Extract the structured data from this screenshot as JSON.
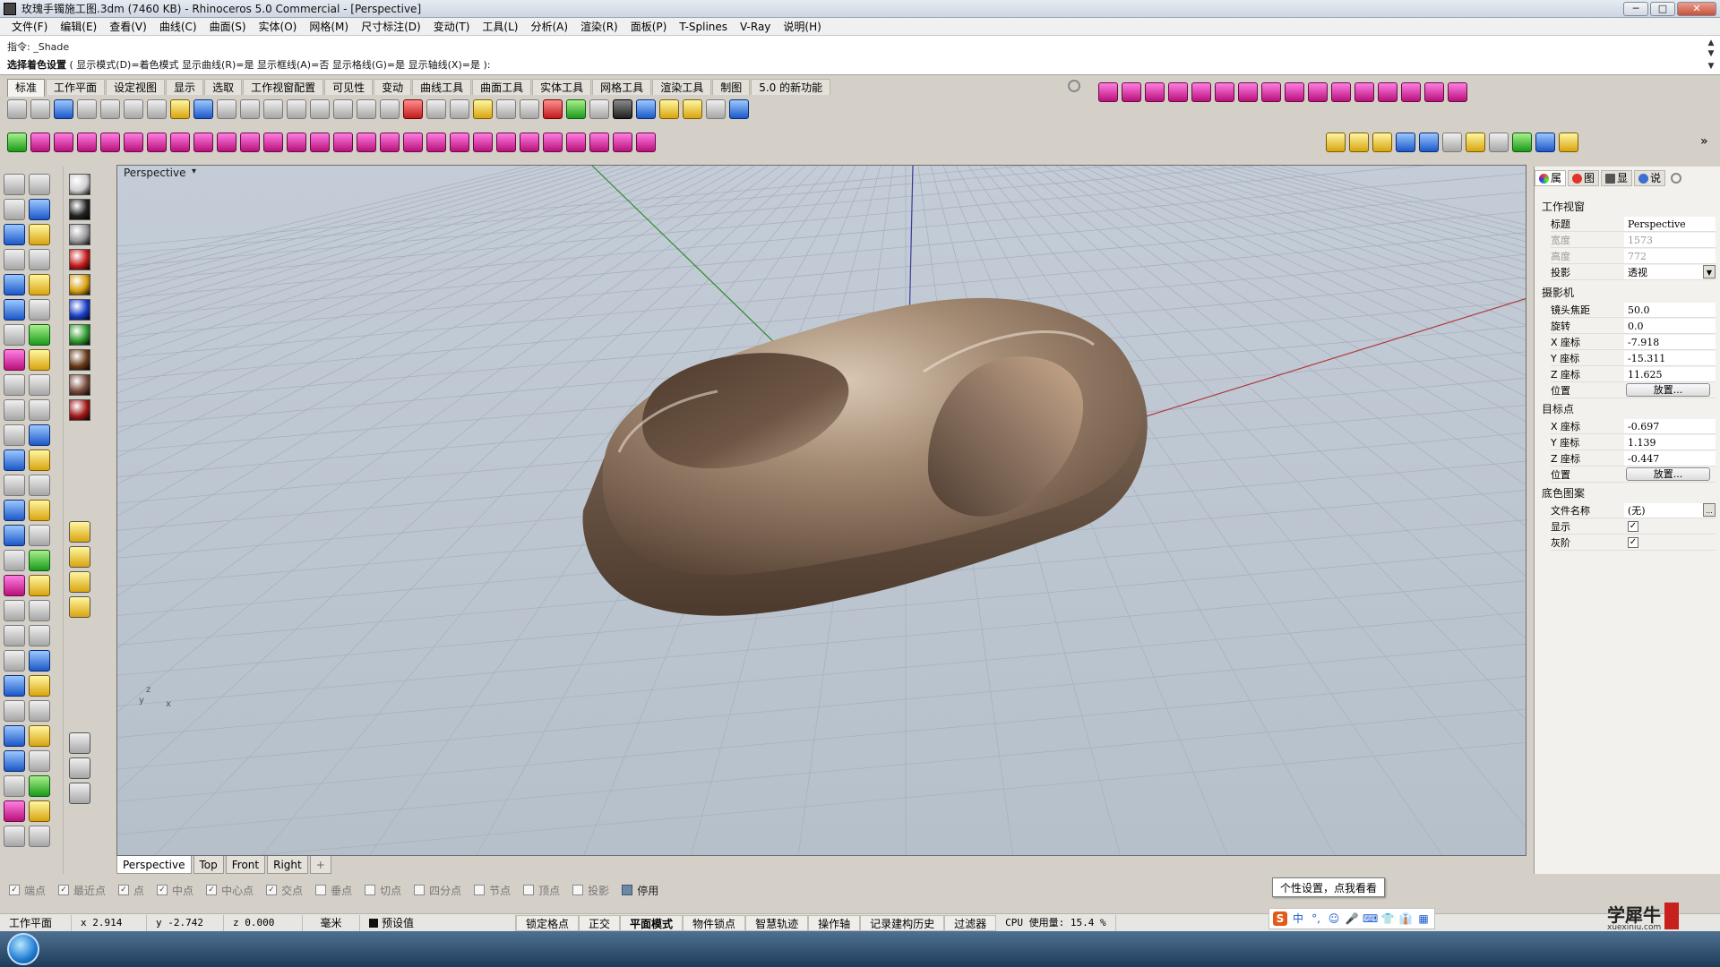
{
  "window": {
    "title": "玫瑰手镯施工图.3dm (7460 KB) - Rhinoceros 5.0 Commercial - [Perspective]",
    "buttons": {
      "minimize": "─",
      "maximize": "□",
      "close": "✕"
    }
  },
  "menubar": [
    "文件(F)",
    "编辑(E)",
    "查看(V)",
    "曲线(C)",
    "曲面(S)",
    "实体(O)",
    "网格(M)",
    "尺寸标注(D)",
    "变动(T)",
    "工具(L)",
    "分析(A)",
    "渲染(R)",
    "面板(P)",
    "T-Splines",
    "V-Ray",
    "说明(H)"
  ],
  "command": {
    "history_prefix": "指令:",
    "history_value": "_Shade",
    "prompt_label": "选择着色设置",
    "prompt_options": "( 显示模式(D)=着色模式  显示曲线(R)=是  显示框线(A)=否  显示格线(G)=是  显示轴线(X)=是 ):"
  },
  "tabs": [
    "标准",
    "工作平面",
    "设定视图",
    "显示",
    "选取",
    "工作视窗配置",
    "可见性",
    "变动",
    "曲线工具",
    "曲面工具",
    "实体工具",
    "网格工具",
    "渲染工具",
    "制图",
    "5.0 的新功能"
  ],
  "toolbar_row1_icons": [
    "new-icon",
    "open-icon",
    "save-icon",
    "print-icon",
    "import-icon",
    "cut-icon",
    "copy-icon",
    "paste-icon",
    "undo-icon",
    "pan-icon",
    "rotate-view-icon",
    "zoom-icon",
    "zoom-window-icon",
    "zoom-extents-icon",
    "zoom-selected-icon",
    "zoom-all-icon",
    "four-view-icon",
    "car-icon",
    "tools-icon",
    "target-icon",
    "light-icon",
    "bulb-icon",
    "lock-icon",
    "shield-icon",
    "color-wheel-icon",
    "sphere-icon",
    "sphere2-icon",
    "render-sphere-icon",
    "paintbrush-icon",
    "gear-icon",
    "dimension-icon",
    "help-icon"
  ],
  "toolbar_row2_icons": [
    "power-icon",
    "tsplines-box-icon",
    "tsplines-cube-icon",
    "tsplines-sphere-icon",
    "tsplines-cylinder-icon",
    "tsplines-torus-icon",
    "tsplines-plane-icon",
    "tsplines-face-icon",
    "tsplines-edge-icon",
    "tsplines-vertex-icon",
    "tsplines-extrude-icon",
    "tsplines-bridge-icon",
    "tsplines-weld-icon",
    "tsplines-crease-icon",
    "tsplines-smooth-icon",
    "tsplines-box-mode-icon",
    "tsplines-grid-icon",
    "tsplines-symmetry-icon",
    "tsplines-split-icon",
    "tsplines-merge-icon",
    "tsplines-fill-icon",
    "tsplines-subdivide-icon",
    "tsplines-append-icon",
    "tsplines-insert-icon",
    "tsplines-delete-icon",
    "tsplines-manip-icon",
    "tsplines-convert-icon",
    "tsplines-repair-icon"
  ],
  "vray_icons": [
    "vray-m-icon",
    "vray-material-icon",
    "vray-tag-icon",
    "vray-r-icon",
    "vray-rt-icon",
    "vray-light-icon",
    "vray-sun-icon",
    "vray-dome-icon",
    "vray-env-icon",
    "vray-help-icon",
    "vray-options-icon"
  ],
  "viewport": {
    "label": "Perspective",
    "menu_arrow": "▾",
    "axis_y": "y",
    "axis_z": "z",
    "axis_x": "x"
  },
  "viewport_tabs": [
    "Perspective",
    "Top",
    "Front",
    "Right",
    "+"
  ],
  "osnap": [
    {
      "label": "端点",
      "checked": true
    },
    {
      "label": "最近点",
      "checked": true
    },
    {
      "label": "点",
      "checked": true
    },
    {
      "label": "中点",
      "checked": true
    },
    {
      "label": "中心点",
      "checked": true
    },
    {
      "label": "交点",
      "checked": true
    },
    {
      "label": "垂点",
      "checked": false
    },
    {
      "label": "切点",
      "checked": false
    },
    {
      "label": "四分点",
      "checked": false
    },
    {
      "label": "节点",
      "checked": false
    },
    {
      "label": "顶点",
      "checked": false
    },
    {
      "label": "投影",
      "checked": false
    },
    {
      "label": "停用",
      "checked": false
    }
  ],
  "statusbar": {
    "cplane": "工作平面",
    "x": "x 2.914",
    "y": "y -2.742",
    "z": "z 0.000",
    "units": "毫米",
    "layer": "预设值",
    "buttons": [
      "锁定格点",
      "正交",
      "平面模式",
      "物件锁点",
      "智慧轨迹",
      "操作轴",
      "记录建构历史",
      "过滤器"
    ],
    "cpu": "CPU 使用量: 15.4 %"
  },
  "properties": {
    "tabs": [
      "属",
      "图",
      "显",
      "说"
    ],
    "section_viewport": "工作视窗",
    "title_label": "标题",
    "title_value": "Perspective",
    "width_label": "宽度",
    "width_value": "1573",
    "height_label": "高度",
    "height_value": "772",
    "projection_label": "投影",
    "projection_value": "透视",
    "section_camera": "摄影机",
    "focal_label": "镜头焦距",
    "focal_value": "50.0",
    "rotation_label": "旋转",
    "rotation_value": "0.0",
    "cam_x_label": "X 座标",
    "cam_x_value": "-7.918",
    "cam_y_label": "Y 座标",
    "cam_y_value": "-15.311",
    "cam_z_label": "Z 座标",
    "cam_z_value": "11.625",
    "cam_pos_label": "位置",
    "place_button": "放置...",
    "section_target": "目标点",
    "tgt_x_label": "X 座标",
    "tgt_x_value": "-0.697",
    "tgt_y_label": "Y 座标",
    "tgt_y_value": "1.139",
    "tgt_z_label": "Z 座标",
    "tgt_z_value": "-0.447",
    "tgt_pos_label": "位置",
    "section_background": "底色图案",
    "filename_label": "文件名称",
    "filename_value": "(无)",
    "show_label": "显示",
    "gray_label": "灰阶",
    "browse_button": "..."
  },
  "ime_tooltip": "个性设置，点我看看",
  "ime_icons": [
    "S",
    "中",
    "°,",
    "☺",
    "🎤",
    "⌨",
    "👕",
    "👔",
    "▦"
  ],
  "watermark": {
    "main": "学犀牛",
    "sub": "xuexiniu.com"
  },
  "colors": {
    "viewport_bg": "#b9c3cd",
    "grid": "#a9b2bc",
    "axis_x": "#b0393d",
    "axis_y": "#2f8a2f",
    "axis_z": "#3a3a9a",
    "model": "#8d7765"
  }
}
